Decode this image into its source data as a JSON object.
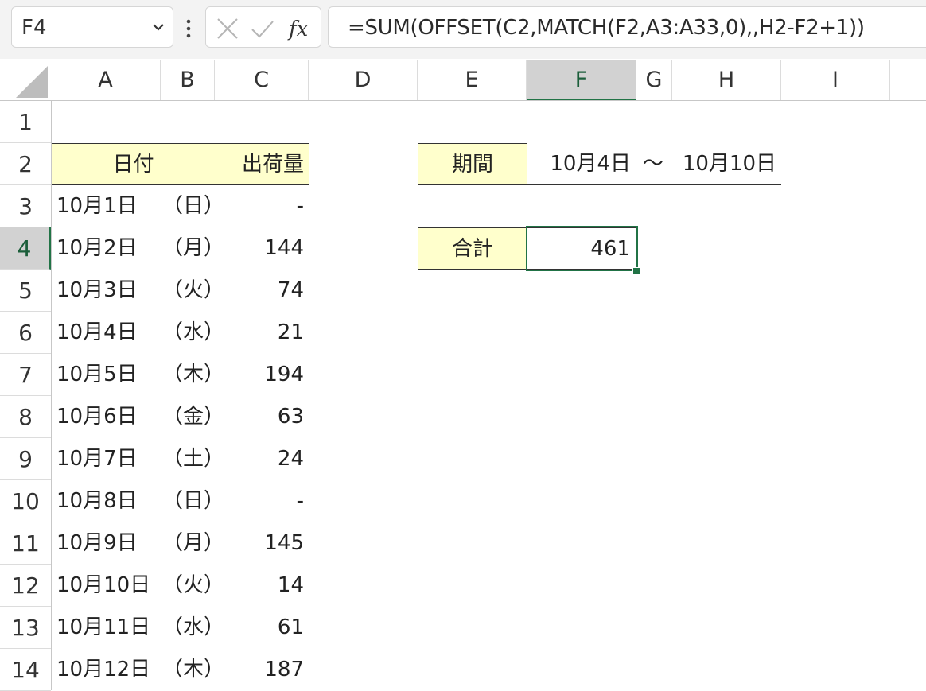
{
  "formula_bar": {
    "name_box": "F4",
    "formula": "=SUM(OFFSET(C2,MATCH(F2,A3:A33,0),,H2-F2+1))"
  },
  "columns": [
    "A",
    "B",
    "C",
    "D",
    "E",
    "F",
    "G",
    "H",
    "I"
  ],
  "rows": [
    "1",
    "2",
    "3",
    "4",
    "5",
    "6",
    "7",
    "8",
    "9",
    "10",
    "11",
    "12",
    "13",
    "14"
  ],
  "active_cell": {
    "column": "F",
    "row": "4"
  },
  "table": {
    "header_date": "日付",
    "header_qty": "出荷量",
    "rows": [
      {
        "date": "10月1日",
        "day": "（日）",
        "qty": "-"
      },
      {
        "date": "10月2日",
        "day": "（月）",
        "qty": "144"
      },
      {
        "date": "10月3日",
        "day": "（火）",
        "qty": "74"
      },
      {
        "date": "10月4日",
        "day": "（水）",
        "qty": "21"
      },
      {
        "date": "10月5日",
        "day": "（木）",
        "qty": "194"
      },
      {
        "date": "10月6日",
        "day": "（金）",
        "qty": "63"
      },
      {
        "date": "10月7日",
        "day": "（土）",
        "qty": "24"
      },
      {
        "date": "10月8日",
        "day": "（日）",
        "qty": "-"
      },
      {
        "date": "10月9日",
        "day": "（月）",
        "qty": "145"
      },
      {
        "date": "10月10日",
        "day": "（火）",
        "qty": "14"
      },
      {
        "date": "10月11日",
        "day": "（水）",
        "qty": "61"
      },
      {
        "date": "10月12日",
        "day": "（木）",
        "qty": "187"
      }
    ]
  },
  "period": {
    "label": "期間",
    "start": "10月4日",
    "separator": "～",
    "end": "10月10日"
  },
  "total": {
    "label": "合計",
    "value": "461"
  },
  "colors": {
    "accent": "#217346",
    "highlight": "#ffffcc"
  }
}
